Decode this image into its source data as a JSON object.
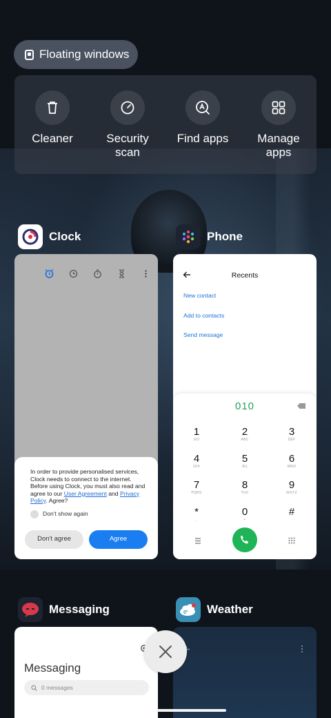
{
  "floating_windows": {
    "label": "Floating windows"
  },
  "quick_actions": [
    {
      "label": "Cleaner",
      "icon": "trash-icon"
    },
    {
      "label": "Security\nscan",
      "icon": "shield-scan-icon"
    },
    {
      "label": "Find apps",
      "icon": "find-apps-icon"
    },
    {
      "label": "Manage\napps",
      "icon": "grid-icon"
    }
  ],
  "apps": {
    "clock": {
      "name": "Clock",
      "consent": {
        "text_before": "In order to provide personalised services, Clock needs to connect to the internet. Before using Clock, you must also read and agree to our ",
        "link1": "User Agreement",
        "text_mid": " and ",
        "link2": "Privacy Policy",
        "text_after": ". Agree?",
        "checkbox_label": "Don't show again",
        "disagree_label": "Don't agree",
        "agree_label": "Agree"
      }
    },
    "phone": {
      "name": "Phone",
      "title": "Recents",
      "links": [
        "New contact",
        "Add to contacts",
        "Send message"
      ],
      "dialed": "010",
      "keys": [
        {
          "d": "1",
          "l": "GO"
        },
        {
          "d": "2",
          "l": "ABC"
        },
        {
          "d": "3",
          "l": "DEF"
        },
        {
          "d": "4",
          "l": "GHI"
        },
        {
          "d": "5",
          "l": "JKL"
        },
        {
          "d": "6",
          "l": "MNO"
        },
        {
          "d": "7",
          "l": "PQRS"
        },
        {
          "d": "8",
          "l": "TUV"
        },
        {
          "d": "9",
          "l": "WXYZ"
        },
        {
          "d": "*",
          "l": ","
        },
        {
          "d": "0",
          "l": "+"
        },
        {
          "d": "#",
          "l": ""
        }
      ]
    },
    "messaging": {
      "name": "Messaging",
      "title": "Messaging",
      "search_placeholder": "0 messages"
    },
    "weather": {
      "name": "Weather",
      "icon_text": "0°"
    }
  },
  "colors": {
    "accent_blue": "#1a7df0",
    "call_green": "#1fb457",
    "dial_green": "#1fa35a"
  }
}
